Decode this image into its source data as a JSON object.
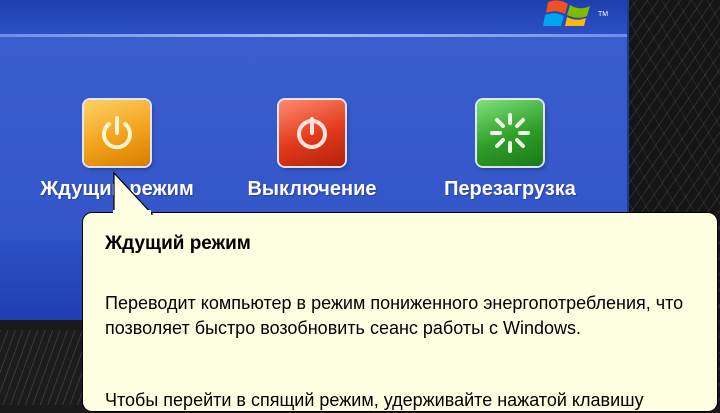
{
  "dialog": {
    "options": [
      {
        "label": "Ждущий режим",
        "icon": "power-standby-icon"
      },
      {
        "label": "Выключение",
        "icon": "power-off-icon"
      },
      {
        "label": "Перезагрузка",
        "icon": "restart-icon"
      }
    ]
  },
  "tooltip": {
    "title": "Ждущий режим",
    "body": "Переводит компьютер в режим пониженного энергопотребления, что позволяет быстро возобновить сеанс работы с Windows.",
    "cut_line": "Чтобы перейти в спящий режим, удерживайте нажатой клавишу"
  },
  "colors": {
    "dialog_blue": "#3c5fcf",
    "tooltip_bg": "#ffffe1",
    "standby": "#f2a21b",
    "off": "#e2391b",
    "restart": "#2f9d28"
  }
}
